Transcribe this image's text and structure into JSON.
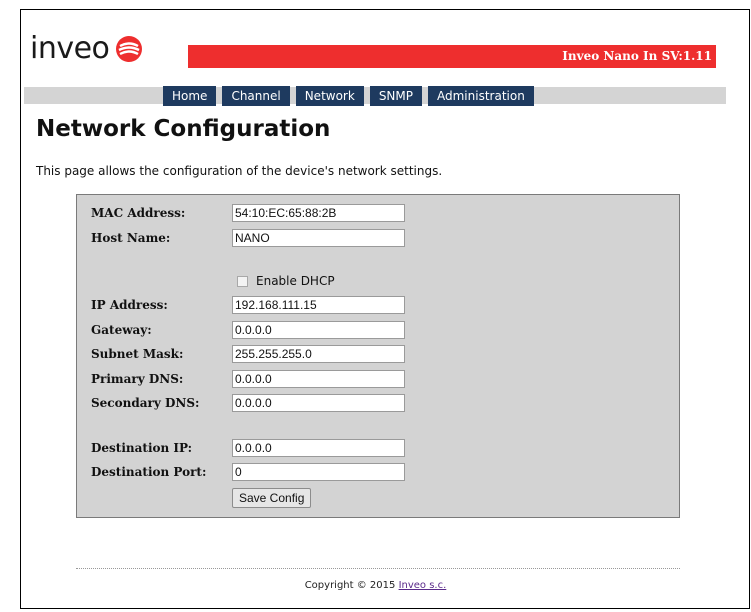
{
  "header": {
    "logo_text": "inveo",
    "version_banner": "Inveo Nano In SV:1.11",
    "colors": {
      "banner": "#ee2e2e",
      "nav": "#1e3a5f",
      "panel": "#d3d3d3"
    }
  },
  "nav": {
    "items": [
      {
        "label": "Home"
      },
      {
        "label": "Channel"
      },
      {
        "label": "Network"
      },
      {
        "label": "SNMP"
      },
      {
        "label": "Administration"
      }
    ]
  },
  "page": {
    "title": "Network Configuration",
    "intro": "This page allows the configuration of the device's network settings."
  },
  "form": {
    "mac_label": "MAC Address:",
    "mac_value": "54:10:EC:65:88:2B",
    "host_label": "Host Name:",
    "host_value": "NANO",
    "dhcp_label": "Enable DHCP",
    "dhcp_checked": false,
    "ip_label": "IP Address:",
    "ip_value": "192.168.111.15",
    "gateway_label": "Gateway:",
    "gateway_value": "0.0.0.0",
    "subnet_label": "Subnet Mask:",
    "subnet_value": "255.255.255.0",
    "pdns_label": "Primary DNS:",
    "pdns_value": "0.0.0.0",
    "sdns_label": "Secondary DNS:",
    "sdns_value": "0.0.0.0",
    "dest_ip_label": "Destination IP:",
    "dest_ip_value": "0.0.0.0",
    "dest_port_label": "Destination Port:",
    "dest_port_value": "0",
    "save_label": "Save Config"
  },
  "footer": {
    "copyright": "Copyright © 2015",
    "company_link": "Inveo s.c."
  }
}
